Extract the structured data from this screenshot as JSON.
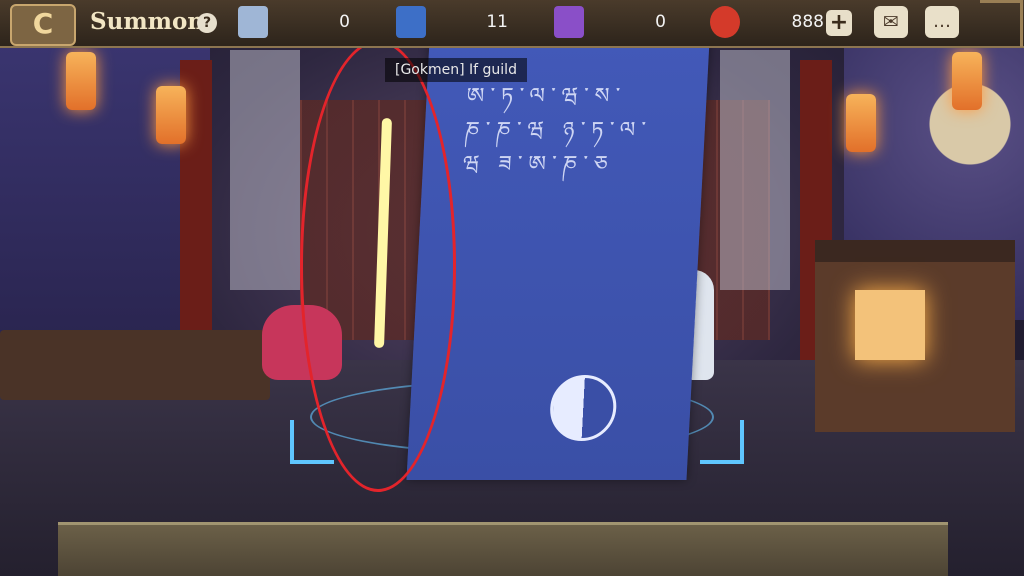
{
  "header": {
    "back_symbol": "C",
    "title": "Summon",
    "help_symbol": "?"
  },
  "resources": [
    {
      "name": "summon-ticket",
      "icon": "blue-ticket-icon",
      "value": "0",
      "color": "#9fb6d6"
    },
    {
      "name": "mystery-scroll",
      "icon": "blue-scroll-icon",
      "value": "11",
      "color": "#3d6fc7"
    },
    {
      "name": "purple-ticket",
      "icon": "purple-ticket-icon",
      "value": "0",
      "color": "#8a4fc8"
    },
    {
      "name": "magatama",
      "icon": "red-magatama-icon",
      "value": "888",
      "color": "#d43a2a"
    }
  ],
  "actions": {
    "plus_symbol": "+",
    "mail_icon": "mail-icon",
    "chat_icon": "chat-icon"
  },
  "notice": {
    "text": "[Gokmen] If guild"
  },
  "banner": {
    "script_text": "ཨ་ཏ་ལ་ཝ་ས་ ཎ་ཎ་ཝ ཉ་ཏ་ལ་ཝ ཟ་ཨ་ཎ་ཅ",
    "symbol": "yin-yang"
  }
}
